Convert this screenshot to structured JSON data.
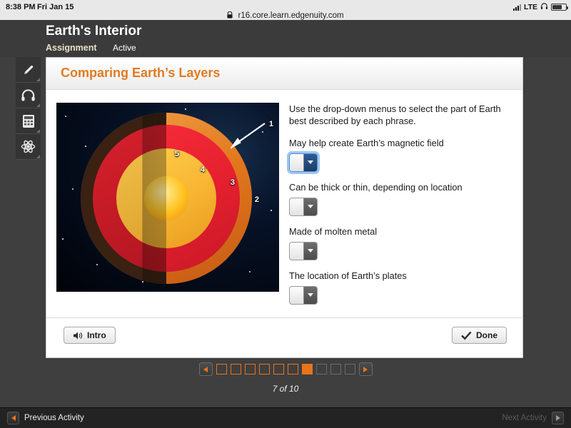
{
  "statusbar": {
    "time": "8:38 PM",
    "date": "Fri Jan 15",
    "url": "r16.core.learn.edgenuity.com",
    "lock_icon": "lock-icon",
    "network_label": "LTE",
    "headphones_icon": "headphones-icon",
    "battery_icon": "battery-icon",
    "signal_icon": "signal-bars-icon"
  },
  "header": {
    "title": "Earth's Interior",
    "tab_assignment": "Assignment",
    "tab_status": "Active"
  },
  "toolbar": {
    "items": [
      {
        "name": "highlighter-icon",
        "label": "Highlighter"
      },
      {
        "name": "headphones-icon",
        "label": "Audio"
      },
      {
        "name": "calculator-icon",
        "label": "Calculator"
      },
      {
        "name": "atom-icon",
        "label": "Periodic Table"
      }
    ]
  },
  "card": {
    "title": "Comparing Earth’s Layers",
    "figure": {
      "alt": "Cutaway diagram of Earth's interior layers",
      "labels": [
        "1",
        "2",
        "3",
        "4",
        "5"
      ],
      "arrow_points_to": "1"
    },
    "instructions": "Use the drop-down menus to select the part of Earth best described by each phrase.",
    "questions": [
      {
        "prompt": "May help create Earth’s magnetic field",
        "value": "",
        "focused": true
      },
      {
        "prompt": "Can be thick or thin, depending on location",
        "value": "",
        "focused": false
      },
      {
        "prompt": "Made of molten metal",
        "value": "",
        "focused": false
      },
      {
        "prompt": "The location of Earth’s plates",
        "value": "",
        "focused": false
      }
    ],
    "intro_label": "Intro",
    "done_label": "Done"
  },
  "pager": {
    "prev_icon": "triangle-left-icon",
    "next_icon": "triangle-right-icon",
    "boxes": [
      {
        "state": "visited"
      },
      {
        "state": "visited"
      },
      {
        "state": "visited"
      },
      {
        "state": "visited"
      },
      {
        "state": "visited"
      },
      {
        "state": "visited"
      },
      {
        "state": "current"
      },
      {
        "state": "locked"
      },
      {
        "state": "locked"
      },
      {
        "state": "locked"
      }
    ],
    "count_label": "7 of 10",
    "current_page": 7,
    "total_pages": 10
  },
  "activity_bar": {
    "previous_label": "Previous Activity",
    "next_label": "Next Activity",
    "next_disabled": true
  },
  "colors": {
    "accent_orange": "#e8741c",
    "title_orange": "#e07b22",
    "header_dark": "#3b3b3b",
    "page_dark": "#3f3f3f",
    "focus_blue": "#9fc6ef"
  }
}
